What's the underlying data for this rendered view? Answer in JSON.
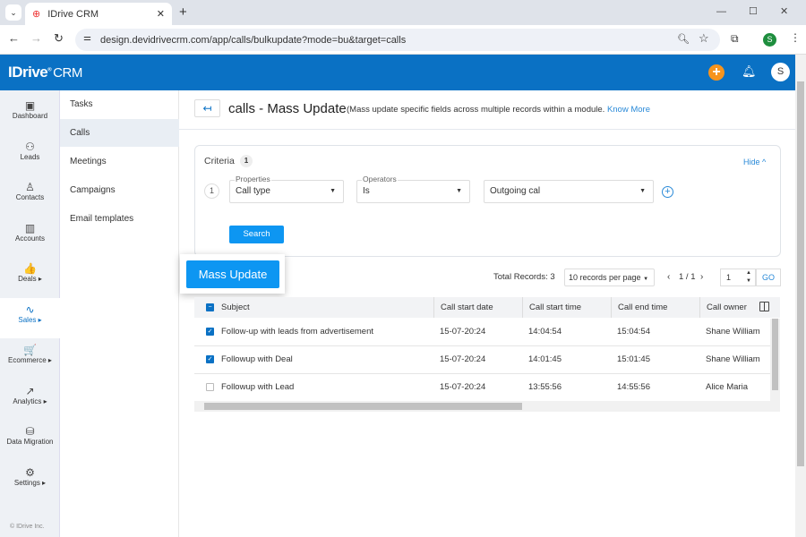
{
  "browser": {
    "tab_title": "IDrive CRM",
    "url": "design.devidrivecrm.com/app/calls/bulkupdate?mode=bu&target=calls",
    "profile": "S"
  },
  "header": {
    "logo": "IDrive CRM",
    "logo_main": "IDrive",
    "logo_sub": "CRM",
    "avatar": "S",
    "accent": "#0a71c4",
    "add_color": "#f7941d"
  },
  "sidebar": {
    "items": [
      {
        "label": "Dashboard",
        "icon": "dashboard-icon",
        "glyph": "▣"
      },
      {
        "label": "Leads",
        "icon": "leads-icon",
        "glyph": "⚇"
      },
      {
        "label": "Contacts",
        "icon": "contacts-icon",
        "glyph": "♙"
      },
      {
        "label": "Accounts",
        "icon": "accounts-icon",
        "glyph": "▥"
      },
      {
        "label": "Deals ▸",
        "icon": "thumbs-up-icon",
        "glyph": "👍"
      },
      {
        "label": "Sales ▸",
        "icon": "pulse-icon",
        "glyph": "∿"
      },
      {
        "label": "Ecommerce ▸",
        "icon": "cart-icon",
        "glyph": "🛒"
      },
      {
        "label": "Analytics ▸",
        "icon": "analytics-icon",
        "glyph": "↗"
      },
      {
        "label": "Data Migration",
        "icon": "database-icon",
        "glyph": "⛁"
      },
      {
        "label": "Settings ▸",
        "icon": "gear-icon",
        "glyph": "⚙"
      }
    ],
    "active": "Sales ▸",
    "footer": "© IDrive Inc."
  },
  "submenu": {
    "items": [
      "Tasks",
      "Calls",
      "Meetings",
      "Campaigns",
      "Email templates"
    ],
    "active": "Calls"
  },
  "page": {
    "title": "calls - Mass Update",
    "subtitle": "(Mass update specific fields across multiple records within a module.",
    "know_more": "Know More"
  },
  "criteria": {
    "label": "Criteria",
    "count": "1",
    "hide": "Hide ^",
    "row_index": "1",
    "properties": {
      "label": "Properties",
      "value": "Call type"
    },
    "operators": {
      "label": "Operators",
      "value": "Is"
    },
    "value": "Outgoing cal",
    "search": "Search"
  },
  "toolbar": {
    "mass_update": "Mass Update",
    "total_records": "Total Records: 3",
    "per_page": "10 records per page",
    "page_info": "1 / 1",
    "page_input": "1",
    "go": "GO"
  },
  "table": {
    "columns": [
      "Subject",
      "Call start date",
      "Call start time",
      "Call end time",
      "Call owner"
    ],
    "rows": [
      {
        "checked": true,
        "cells": [
          "Follow-up with leads from advertisement",
          "15-07-20:24",
          "14:04:54",
          "15:04:54",
          "Shane William"
        ]
      },
      {
        "checked": true,
        "cells": [
          "Followup with Deal",
          "15-07-20:24",
          "14:01:45",
          "15:01:45",
          "Shane William"
        ]
      },
      {
        "checked": false,
        "cells": [
          "Followup with Lead",
          "15-07-20:24",
          "13:55:56",
          "14:55:56",
          "Alice Maria"
        ]
      }
    ]
  }
}
